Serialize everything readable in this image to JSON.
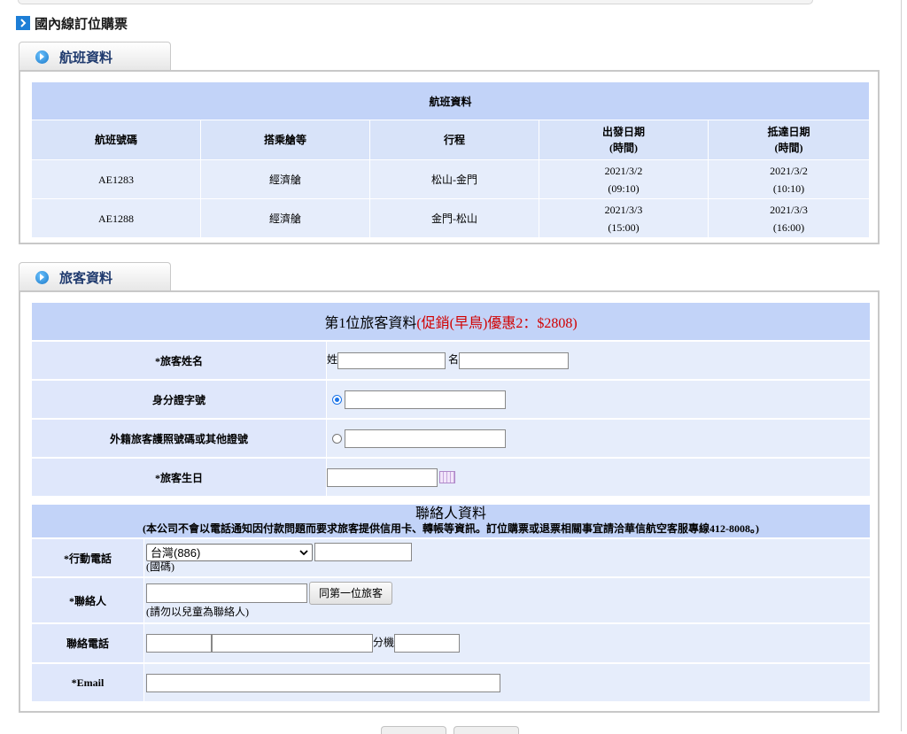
{
  "page_title": "國內線訂位購票",
  "flight_section": {
    "tab_label": "航班資料",
    "caption": "航班資料",
    "headers": {
      "flight_no": "航班號碼",
      "cabin": "搭乘艙等",
      "route": "行程",
      "dep_line1": "出發日期",
      "dep_line2": "(時間)",
      "arr_line1": "抵達日期",
      "arr_line2": "(時間)"
    },
    "rows": [
      {
        "flight_no": "AE1283",
        "cabin": "經濟艙",
        "route": "松山-金門",
        "dep_date": "2021/3/2",
        "dep_time": "(09:10)",
        "arr_date": "2021/3/2",
        "arr_time": "(10:10)"
      },
      {
        "flight_no": "AE1288",
        "cabin": "經濟艙",
        "route": "金門-松山",
        "dep_date": "2021/3/3",
        "dep_time": "(15:00)",
        "arr_date": "2021/3/3",
        "arr_time": "(16:00)"
      }
    ]
  },
  "passenger_section": {
    "tab_label": "旅客資料",
    "caption_prefix": "第1位旅客資料",
    "caption_promo": "(促銷(早鳥)優惠2：$2808)",
    "name_label": "*旅客姓名",
    "surname_prefix": "姓",
    "given_prefix": "名",
    "surname_value": "",
    "given_value": "",
    "id_label": "身分證字號",
    "id_value": "",
    "passport_label": "外籍旅客護照號碼或其他證號",
    "passport_value": "",
    "birthday_label": "*旅客生日",
    "birthday_value": ""
  },
  "contact_section": {
    "title": "聯絡人資料",
    "note": "(本公司不會以電話通知因付款問題而要求旅客提供信用卡、轉帳等資訊。訂位購票或退票相關事宜請洽華信航空客服專線412-8008。)",
    "mobile_label": "*行動電話",
    "country_selected": "台灣(886)",
    "country_hint": "(國碼)",
    "mobile_value": "",
    "contact_label": "*聯絡人",
    "contact_value": "",
    "same_as_first_button": "同第一位旅客",
    "contact_hint": "(請勿以兒童為聯絡人)",
    "phone_label": "聯絡電話",
    "ext_prefix": "分機",
    "email_label": "*Email",
    "email_value": ""
  },
  "colors": {
    "caption_bg": "#c2d3f8",
    "header_bg": "#d8e3f9",
    "row_bg": "#e6edfb",
    "promo_red": "#d10000",
    "title_arrow": "#1d7ed6"
  }
}
